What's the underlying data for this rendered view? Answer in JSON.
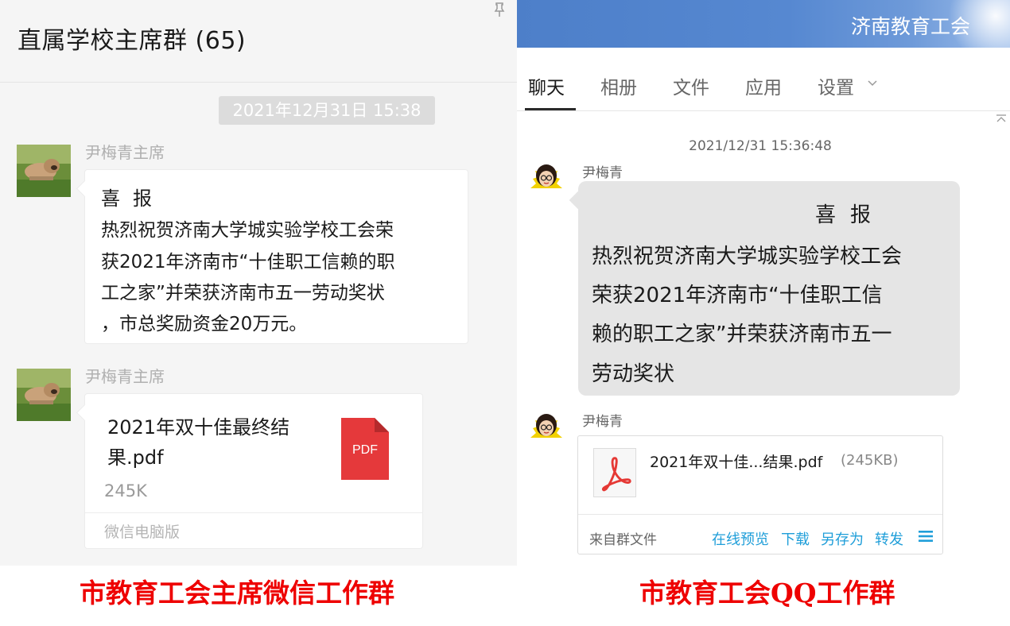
{
  "wechat": {
    "title": "直属学校主席群 (65)",
    "timestamp": "2021年12月31日 15:38",
    "messages": [
      {
        "sender": "尹梅青主席",
        "heading": "喜报",
        "lines": [
          "热烈祝贺济南大学城实验学校工会荣",
          "获2021年济南市“十佳职工信赖的职",
          "工之家”并荣获济南市五一劳动奖状",
          "，市总奖励资金20万元。"
        ]
      },
      {
        "sender": "尹梅青主席",
        "file": {
          "name_line1": "2021年双十佳最终结",
          "name_line2": "果.pdf",
          "size": "245K",
          "icon_label": "PDF",
          "icon": "pdf-file-icon",
          "source": "微信电脑版"
        }
      }
    ]
  },
  "qq": {
    "banner_title": "济南教育工会",
    "tabs": [
      {
        "label": "聊天",
        "active": true
      },
      {
        "label": "相册",
        "active": false
      },
      {
        "label": "文件",
        "active": false
      },
      {
        "label": "应用",
        "active": false
      },
      {
        "label": "设置",
        "active": false,
        "dropdown": true
      }
    ],
    "timestamp": "2021/12/31 15:36:48",
    "messages": [
      {
        "sender": "尹梅青",
        "heading": "喜报",
        "lines": [
          "热烈祝贺济南大学城实验学校工会",
          "荣获2021年济南市“十佳职工信",
          "赖的职工之家”并荣获济南市五一",
          "劳动奖状"
        ]
      },
      {
        "sender": "尹梅青",
        "file": {
          "name": "2021年双十佳...结果.pdf",
          "size": "(245KB)",
          "source": "来自群文件",
          "actions": [
            "在线预览",
            "下载",
            "另存为",
            "转发"
          ],
          "icon": "adobe-pdf-icon"
        }
      }
    ]
  },
  "captions": {
    "left": "市教育工会主席微信工作群",
    "right": "市教育工会QQ工作群"
  },
  "colors": {
    "caption": "#ee0000",
    "qq_banner": "#4d7fc9",
    "qq_link": "#1f9ed9",
    "pdf_red": "#e5393b"
  }
}
